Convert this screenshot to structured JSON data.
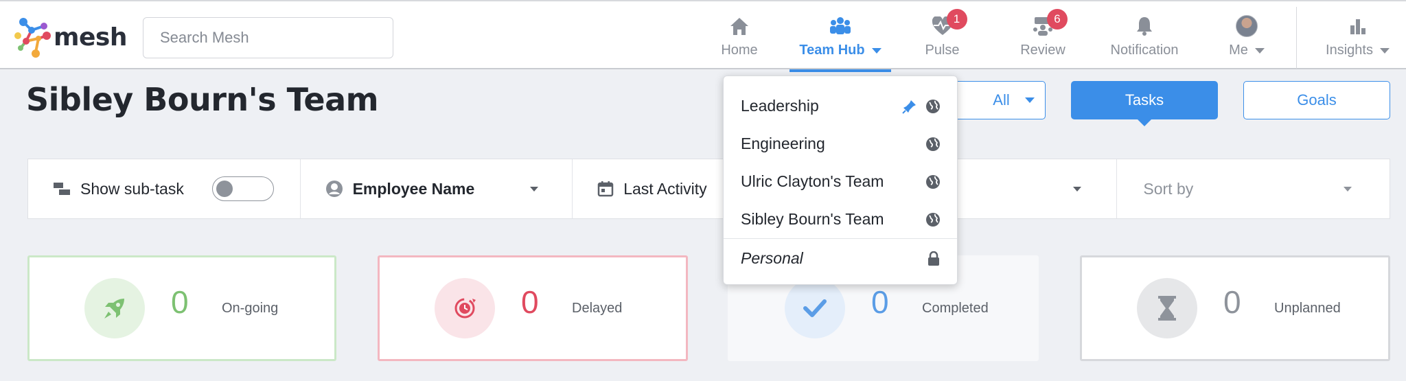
{
  "brand": {
    "name": "mesh"
  },
  "search": {
    "placeholder": "Search Mesh",
    "value": ""
  },
  "nav": {
    "items": [
      {
        "label": "Home",
        "icon": "home-icon"
      },
      {
        "label": "Team Hub",
        "icon": "team-icon",
        "active": true
      },
      {
        "label": "Pulse",
        "icon": "heart-pulse-icon",
        "badge": "1"
      },
      {
        "label": "Review",
        "icon": "review-icon",
        "badge": "6"
      },
      {
        "label": "Notification",
        "icon": "bell-icon"
      },
      {
        "label": "Me",
        "icon": "avatar"
      },
      {
        "label": "Insights",
        "icon": "bar-chart-icon"
      }
    ]
  },
  "page": {
    "title": "Sibley Bourn's Team"
  },
  "buttons": {
    "all": "All",
    "tasks": "Tasks",
    "goals": "Goals"
  },
  "filters": {
    "show_subtask": "Show sub-task",
    "subtask_enabled": false,
    "employee": "Employee Name",
    "last_activity": "Last Activity",
    "sort_by": "Sort by"
  },
  "team_menu": {
    "items": [
      {
        "label": "Leadership",
        "pinned": true,
        "visibility": "public"
      },
      {
        "label": "Engineering",
        "visibility": "public"
      },
      {
        "label": "Ulric Clayton's Team",
        "visibility": "public"
      },
      {
        "label": "Sibley Bourn's Team",
        "visibility": "public"
      },
      {
        "label": "Personal",
        "visibility": "private"
      }
    ]
  },
  "stats": [
    {
      "count": "0",
      "label": "On-going",
      "icon": "rocket-icon",
      "color": "#7dc172"
    },
    {
      "count": "0",
      "label": "Delayed",
      "icon": "clock-alert-icon",
      "color": "#e04a5f"
    },
    {
      "count": "0",
      "label": "Completed",
      "icon": "check-icon",
      "color": "#5b9de6"
    },
    {
      "count": "0",
      "label": "Unplanned",
      "icon": "hourglass-icon",
      "color": "#8e939b"
    }
  ],
  "colors": {
    "accent": "#3b8ee8",
    "badge": "#e04a5f"
  }
}
